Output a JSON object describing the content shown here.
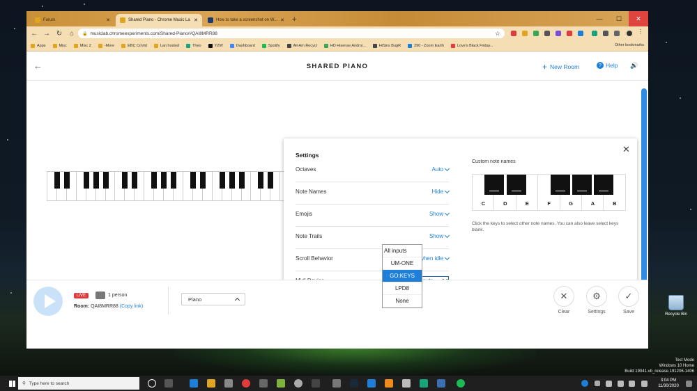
{
  "browser": {
    "tabs": [
      {
        "label": "Forum",
        "color": "#e0a520"
      },
      {
        "label": "Shared Piano - Chrome Music La",
        "color": "#e0a520"
      },
      {
        "label": "How to take a screenshot on W...",
        "color": "#1f3b6e"
      }
    ],
    "url": "musiclab.chromeexperiments.com/Shared-Piano/#QAI8MRR88",
    "bookmarks": [
      "Apps",
      "Misc",
      "Misc 2",
      "-More",
      "EBC CoVid",
      "Lan hosted",
      "Theo",
      "YZW",
      "Dashboard",
      "Spotify",
      "All-Am Recycl",
      "HD Hisense Androi...",
      "HiSins BugR",
      "290 - Zoom Earth",
      "Love's Black Friday..."
    ],
    "other_bookmarks": "Other bookmarks"
  },
  "header": {
    "title": "SHARED PIANO",
    "new_room": "New Room",
    "help": "Help"
  },
  "settings": {
    "title": "Settings",
    "rows": [
      {
        "label": "Octaves",
        "value": "Auto"
      },
      {
        "label": "Note Names",
        "value": "Hide"
      },
      {
        "label": "Emojis",
        "value": "Show"
      },
      {
        "label": "Note Trails",
        "value": "Show"
      },
      {
        "label": "Scroll Behavior",
        "value": "Pause when idle"
      }
    ],
    "midi_label": "Midi Device",
    "midi_value": "All inputs",
    "midi_options": [
      "All inputs",
      "UM-ONE",
      "GO:KEYS",
      "LPD8",
      "None"
    ],
    "midi_highlighted": "GO:KEYS",
    "custom_title": "Custom note names",
    "note_letters": [
      "C",
      "D",
      "E",
      "F",
      "G",
      "A",
      "B"
    ],
    "custom_help": "Click the keys to select other note names. You can also leave select keys blank."
  },
  "bottom": {
    "live": "LIVE",
    "persons": "1 person",
    "room_label": "Room:",
    "room_code": "QAI8MRR88",
    "copy_link": "(Copy link)",
    "instrument": "Piano",
    "clear": "Clear",
    "settings": "Settings",
    "save": "Save"
  },
  "desktop": {
    "recycle_bin": "Recycle Bin",
    "watermark_1": "Test Mode",
    "watermark_2": "Windows 10 Home",
    "watermark_3": "Build 19041.vb_release.191206-1406"
  },
  "taskbar": {
    "search_placeholder": "Type here to search",
    "time": "3:04 PM",
    "date": "11/30/2020"
  },
  "colors": {
    "accent": "#1e7fd8",
    "live": "#e23b3b",
    "browser_theme": "#d9a453"
  }
}
